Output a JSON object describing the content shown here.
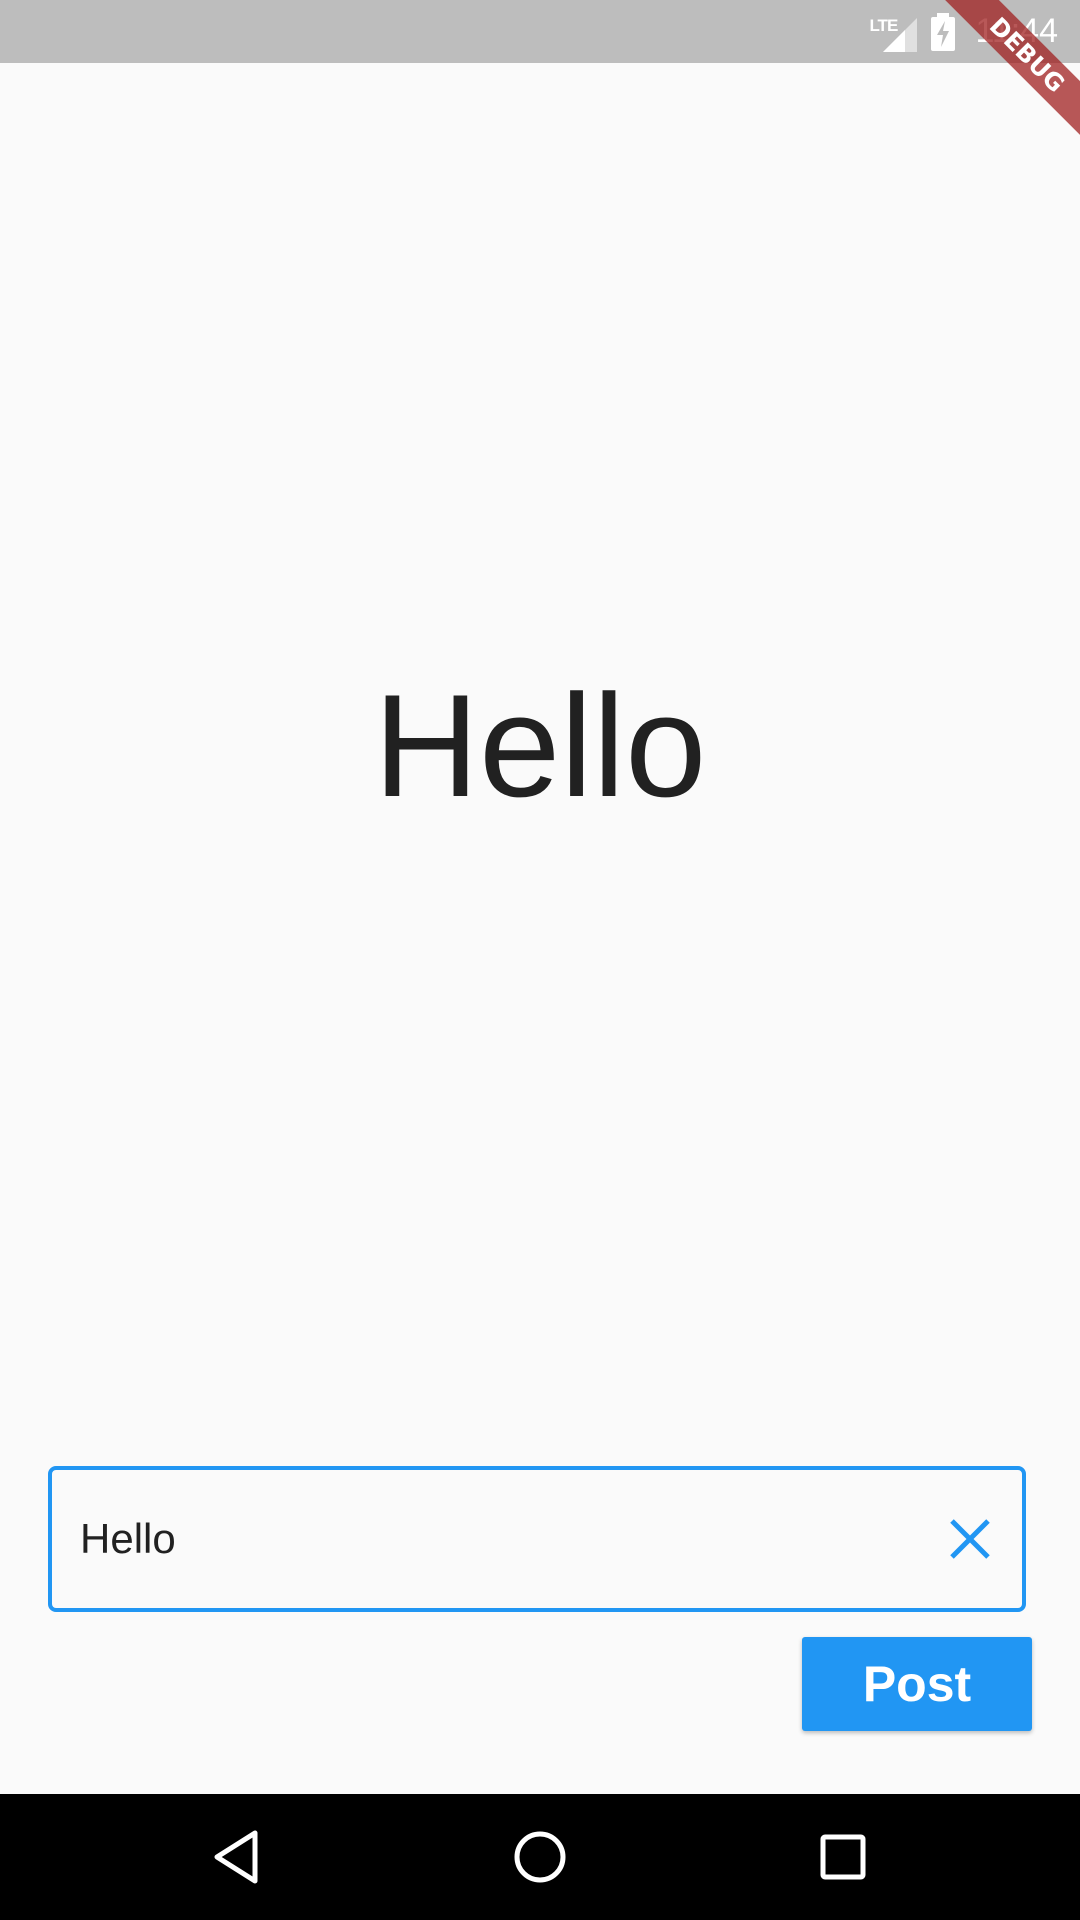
{
  "status_bar": {
    "network": "LTE",
    "time": "11:44"
  },
  "debug_banner": {
    "label": "DEBUG",
    "color": "#a02020"
  },
  "main": {
    "display_text": "Hello",
    "input": {
      "value": "Hello",
      "clear_icon": "close-icon"
    },
    "post_button_label": "Post"
  },
  "nav_bar": {
    "back_icon": "back-triangle-icon",
    "home_icon": "home-circle-icon",
    "recents_icon": "recents-square-icon"
  },
  "colors": {
    "accent": "#2196f3",
    "background": "#fafafa",
    "status_bar": "#bdbdbd",
    "nav_bar": "#000000",
    "text": "#212121"
  }
}
